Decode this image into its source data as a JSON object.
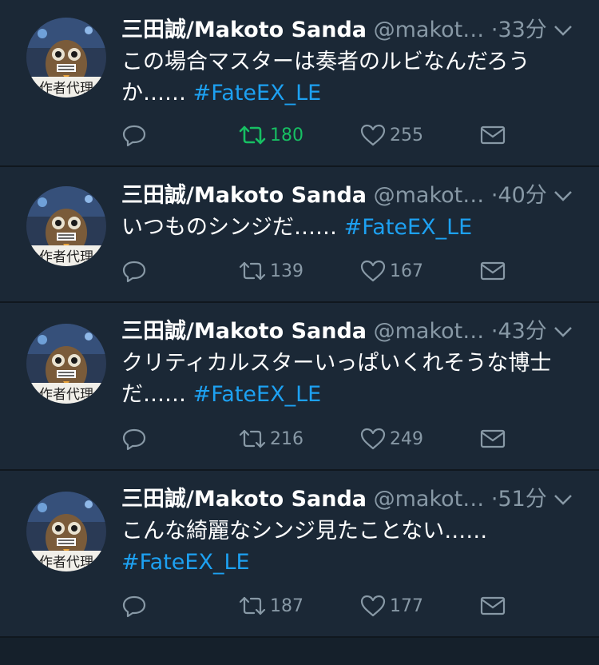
{
  "tweets": [
    {
      "name": "三田誠/Makoto Sanda",
      "handle": "@makot…",
      "time": "33分",
      "text": "この場合マスターは奏者のルビなんだろうか……",
      "hashtag": "#FateEX_LE",
      "retweets": "180",
      "likes": "255",
      "retweeted": true
    },
    {
      "name": "三田誠/Makoto Sanda",
      "handle": "@makot…",
      "time": "40分",
      "text": "いつものシンジだ……",
      "hashtag": "#FateEX_LE",
      "retweets": "139",
      "likes": "167",
      "retweeted": false
    },
    {
      "name": "三田誠/Makoto Sanda",
      "handle": "@makot…",
      "time": "43分",
      "text": "クリティカルスターいっぱいくれそうな博士だ……",
      "hashtag": "#FateEX_LE",
      "retweets": "216",
      "likes": "249",
      "retweeted": false
    },
    {
      "name": "三田誠/Makoto Sanda",
      "handle": "@makot…",
      "time": "51分",
      "text": "こんな綺麗なシンジ見たことない……",
      "hashtag": "#FateEX_LE",
      "retweets": "187",
      "likes": "177",
      "retweeted": false
    }
  ],
  "avatar_caption": "作者代理",
  "separator": "·",
  "colors": {
    "background": "#15202b",
    "card": "#1b2836",
    "secondary_text": "#8899a6",
    "link": "#1da1f2",
    "retweet_active": "#17bf63"
  },
  "icons": [
    "reply-icon",
    "retweet-icon",
    "like-icon",
    "dm-icon",
    "chevron-down-icon"
  ]
}
